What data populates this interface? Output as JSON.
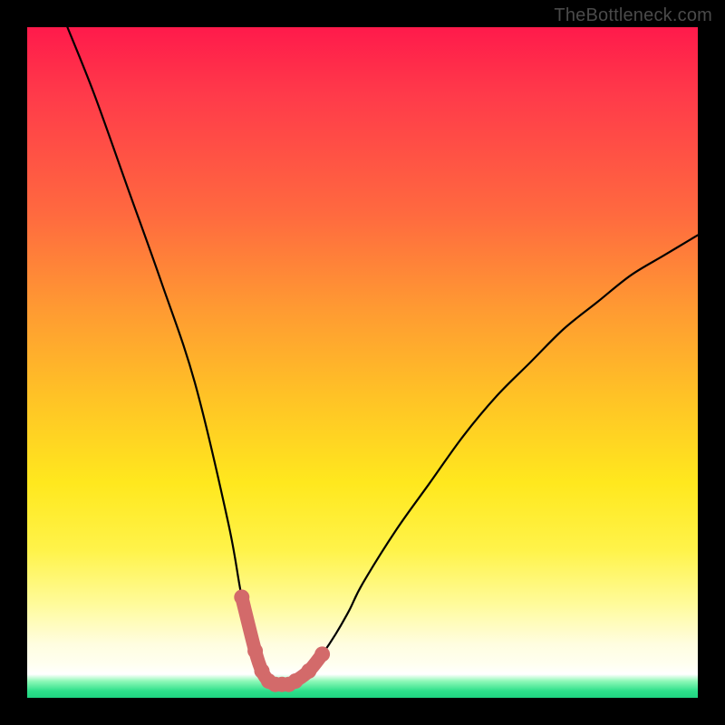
{
  "watermark": "TheBottleneck.com",
  "colors": {
    "background": "#000000",
    "curve": "#000000",
    "marker": "#d36a6a",
    "gradient_top": "#ff1a4b",
    "gradient_bottom": "#1fd481"
  },
  "chart_data": {
    "type": "line",
    "title": "",
    "xlabel": "",
    "ylabel": "",
    "xlim": [
      0,
      100
    ],
    "ylim": [
      0,
      100
    ],
    "series": [
      {
        "name": "bottleneck-curve",
        "x": [
          6,
          10,
          15,
          20,
          25,
          30,
          32,
          34,
          35,
          36,
          37,
          38,
          39,
          40,
          42,
          44,
          46,
          48,
          50,
          55,
          60,
          65,
          70,
          75,
          80,
          85,
          90,
          95,
          100
        ],
        "y": [
          100,
          90,
          76,
          62,
          47,
          26,
          15,
          7,
          4,
          2.5,
          2,
          2,
          2,
          2.5,
          4,
          6.5,
          9.5,
          13,
          17,
          25,
          32,
          39,
          45,
          50,
          55,
          59,
          63,
          66,
          69
        ]
      }
    ],
    "markers": {
      "name": "highlighted-points",
      "x": [
        32,
        34,
        35,
        36,
        37,
        38,
        39,
        40,
        42,
        44
      ],
      "y": [
        15,
        7,
        4,
        2.5,
        2,
        2,
        2,
        2.5,
        4,
        6.5
      ]
    }
  }
}
